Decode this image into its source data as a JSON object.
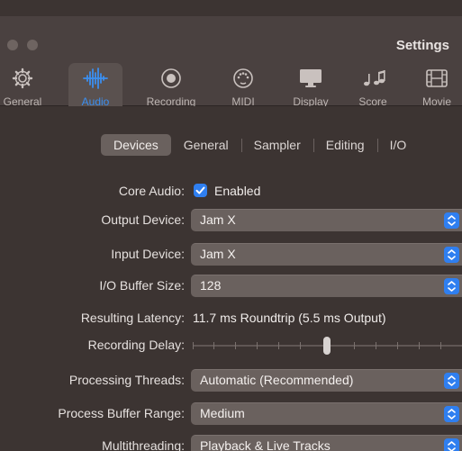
{
  "window": {
    "title": "Settings"
  },
  "toolbar": {
    "items": [
      {
        "label": "General",
        "icon": "gear-icon"
      },
      {
        "label": "Audio",
        "icon": "waveform-icon",
        "selected": true
      },
      {
        "label": "Recording",
        "icon": "record-icon"
      },
      {
        "label": "MIDI",
        "icon": "midi-port-icon"
      },
      {
        "label": "Display",
        "icon": "display-icon"
      },
      {
        "label": "Score",
        "icon": "music-notes-icon"
      },
      {
        "label": "Movie",
        "icon": "film-icon"
      }
    ]
  },
  "tabs": [
    {
      "label": "Devices",
      "active": true
    },
    {
      "label": "General"
    },
    {
      "label": "Sampler"
    },
    {
      "label": "Editing"
    },
    {
      "label": "I/O"
    }
  ],
  "form": {
    "core_audio": {
      "label": "Core Audio:",
      "checkbox_label": "Enabled",
      "checked": true
    },
    "output_device": {
      "label": "Output Device:",
      "value": "Jam X"
    },
    "input_device": {
      "label": "Input Device:",
      "value": "Jam X"
    },
    "io_buffer_size": {
      "label": "I/O Buffer Size:",
      "value": "128"
    },
    "resulting_latency": {
      "label": "Resulting Latency:",
      "value": "11.7 ms Roundtrip (5.5 ms Output)"
    },
    "recording_delay": {
      "label": "Recording Delay:",
      "slider_position": 0.5
    },
    "processing_threads": {
      "label": "Processing Threads:",
      "value": "Automatic (Recommended)"
    },
    "process_buffer_range": {
      "label": "Process Buffer Range:",
      "value": "Medium"
    },
    "multithreading": {
      "label": "Multithreading:",
      "value": "Playback & Live Tracks"
    }
  },
  "colors": {
    "accent": "#2f7ff0",
    "background": "#3c3432",
    "control": "#6a615e"
  }
}
